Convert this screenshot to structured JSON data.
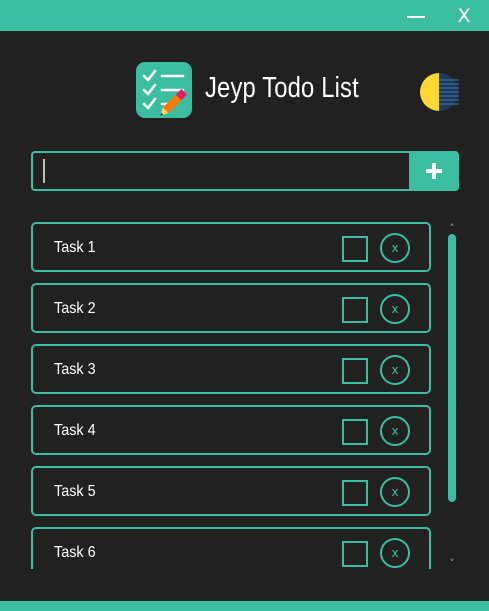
{
  "window": {
    "minimize_icon": "minimize-icon",
    "close_label": "X"
  },
  "header": {
    "logo_icon": "checklist-pencil-icon",
    "title": "Jeyp Todo List",
    "theme_icon": "half-moon-theme-icon"
  },
  "new_task": {
    "value": "",
    "placeholder": "",
    "add_icon": "plus-icon"
  },
  "tasks": [
    {
      "label": "Task 1",
      "done": false,
      "delete_label": "x"
    },
    {
      "label": "Task 2",
      "done": false,
      "delete_label": "x"
    },
    {
      "label": "Task 3",
      "done": false,
      "delete_label": "x"
    },
    {
      "label": "Task 4",
      "done": false,
      "delete_label": "x"
    },
    {
      "label": "Task 5",
      "done": false,
      "delete_label": "x"
    },
    {
      "label": "Task 6",
      "done": false,
      "delete_label": "x"
    }
  ],
  "scrollbar": {
    "up_glyph": "˄",
    "down_glyph": "˅",
    "visible_fraction": 0.83,
    "position_fraction": 0
  },
  "colors": {
    "accent": "#3bbea0",
    "background": "#212121",
    "text": "#ffffff",
    "sun": "#fdd835",
    "moon": "#1e3a5f"
  }
}
